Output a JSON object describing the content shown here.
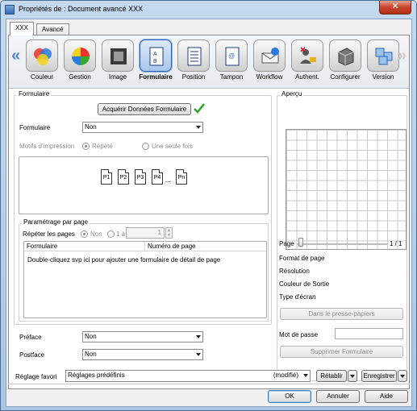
{
  "window": {
    "title": "Propriétés de : Document avancé XXX",
    "close": "✕"
  },
  "tabs": [
    "XXX",
    "Avancé"
  ],
  "ribbon": {
    "left_arrow": "«",
    "right_arrow": "»",
    "items": [
      {
        "label": "Couleur",
        "icon": "color-circles-icon"
      },
      {
        "label": "Gestion",
        "icon": "gestion-icon"
      },
      {
        "label": "Image",
        "icon": "image-icon"
      },
      {
        "label": "Formulaire",
        "icon": "form-icon",
        "selected": true
      },
      {
        "label": "Position",
        "icon": "position-icon"
      },
      {
        "label": "Tampon",
        "icon": "stamp-icon"
      },
      {
        "label": "Workflow",
        "icon": "workflow-icon"
      },
      {
        "label": "Authent.",
        "icon": "auth-icon"
      },
      {
        "label": "Configurer",
        "icon": "config-icon"
      },
      {
        "label": "Version",
        "icon": "version-icon"
      }
    ]
  },
  "form": {
    "group_title": "Formulaire",
    "acquire_button": "Acquérir Données Formulaire",
    "formulaire_label": "Formulaire",
    "formulaire_value": "Non",
    "motifs_label": "Motifs d'impression",
    "repete": "Répété",
    "seule_fois": "Une seule fois",
    "pages": [
      "P1",
      "P2",
      "P3",
      "P4",
      "Pn"
    ],
    "ellipsis": "...",
    "param_title": "Paramétrage par page",
    "repeter_label": "Répéter les pages",
    "non": "Non",
    "un_a": "1 à",
    "spin_value": "1",
    "col_form": "Formulaire",
    "col_num": "Numéro de page",
    "hint": "Double-cliquez svp ici pour ajouter une formulaire de détail de page",
    "preface_label": "Préface",
    "preface_value": "Non",
    "postface_label": "Postface",
    "postface_value": "Non"
  },
  "preview": {
    "title": "Aperçu",
    "page_label": "Page",
    "page_count": "1 / 1",
    "format": "Format de page",
    "resolution": "Résolution",
    "couleur": "Couleur de Sortie",
    "ecran": "Type d'écran",
    "clipboard": "Dans le presse-papiers",
    "motdepasse": "Mot de passe",
    "supprimer": "Supprimer Formulaire"
  },
  "footer": {
    "favori_label": "Réglage favori",
    "favori_value": "Réglages prédéfinis",
    "modifie": "(modifié)",
    "retablir": "Rétablir",
    "enregistrer": "Enregistrer",
    "ok": "OK",
    "annuler": "Annuler",
    "aide": "Aide"
  },
  "colors": {
    "accent": "#2d62b0",
    "check": "#2aa52a"
  }
}
